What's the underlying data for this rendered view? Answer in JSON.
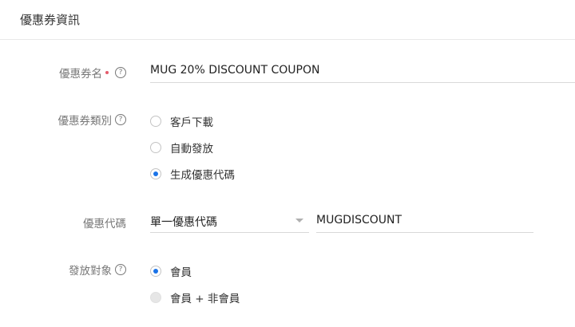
{
  "header": {
    "title": "優惠券資訊"
  },
  "coupon_name": {
    "label": "優惠券名",
    "value": "MUG 20% DISCOUNT COUPON",
    "required": true
  },
  "coupon_type": {
    "label": "優惠券類別",
    "options": [
      {
        "label": "客戶下載",
        "checked": false
      },
      {
        "label": "自動發放",
        "checked": false
      },
      {
        "label": "生成優惠代碼",
        "checked": true
      }
    ]
  },
  "coupon_code": {
    "label": "優惠代碼",
    "select_value": "單一優惠代碼",
    "code_value": "MUGDISCOUNT"
  },
  "target": {
    "label": "發放對象",
    "options": [
      {
        "label": "會員",
        "checked": true,
        "disabled": false
      },
      {
        "label": "會員 + 非會員",
        "checked": false,
        "disabled": true
      }
    ]
  },
  "icons": {
    "help": "?"
  },
  "colors": {
    "accent": "#1a73e8",
    "required": "#e45c6c"
  }
}
